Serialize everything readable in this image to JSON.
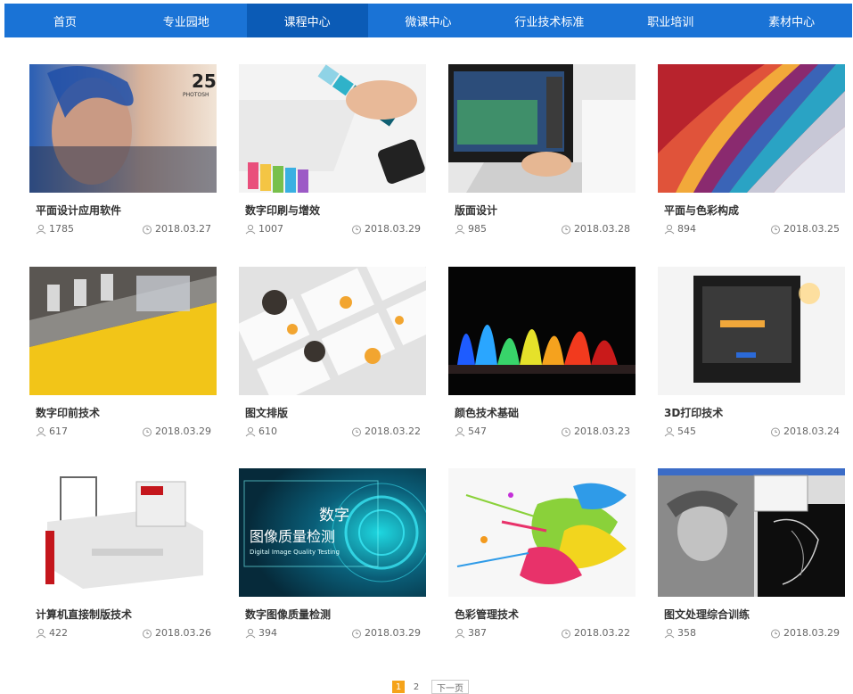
{
  "nav": {
    "items": [
      {
        "label": "首页"
      },
      {
        "label": "专业园地"
      },
      {
        "label": "课程中心"
      },
      {
        "label": "微课中心"
      },
      {
        "label": "行业技术标准"
      },
      {
        "label": "职业培训"
      },
      {
        "label": "素材中心"
      }
    ],
    "active_index": 2
  },
  "courses": [
    {
      "title": "平面设计应用软件",
      "views": "1785",
      "date": "2018.03.27",
      "thumb_text": "25",
      "thumb_sub": "PHOTOSH"
    },
    {
      "title": "数字印刷与增效",
      "views": "1007",
      "date": "2018.03.29"
    },
    {
      "title": "版面设计",
      "views": "985",
      "date": "2018.03.28"
    },
    {
      "title": "平面与色彩构成",
      "views": "894",
      "date": "2018.03.25"
    },
    {
      "title": "数字印前技术",
      "views": "617",
      "date": "2018.03.29"
    },
    {
      "title": "图文排版",
      "views": "610",
      "date": "2018.03.22"
    },
    {
      "title": "颜色技术基础",
      "views": "547",
      "date": "2018.03.23"
    },
    {
      "title": "3D打印技术",
      "views": "545",
      "date": "2018.03.24"
    },
    {
      "title": "计算机直接制版技术",
      "views": "422",
      "date": "2018.03.26"
    },
    {
      "title": "数字图像质量检测",
      "views": "394",
      "date": "2018.03.29",
      "thumb_text": "数字",
      "thumb_text2": "图像质量检测",
      "thumb_sub": "Digital Image Quality Testing"
    },
    {
      "title": "色彩管理技术",
      "views": "387",
      "date": "2018.03.22"
    },
    {
      "title": "图文处理综合训练",
      "views": "358",
      "date": "2018.03.29"
    }
  ],
  "pagination": {
    "current": "1",
    "pages": [
      "2"
    ],
    "next_label": "下一页"
  },
  "colors": {
    "nav_bg": "#1a73d6",
    "nav_active": "#0b5bb6",
    "page_current": "#f5a31a"
  }
}
